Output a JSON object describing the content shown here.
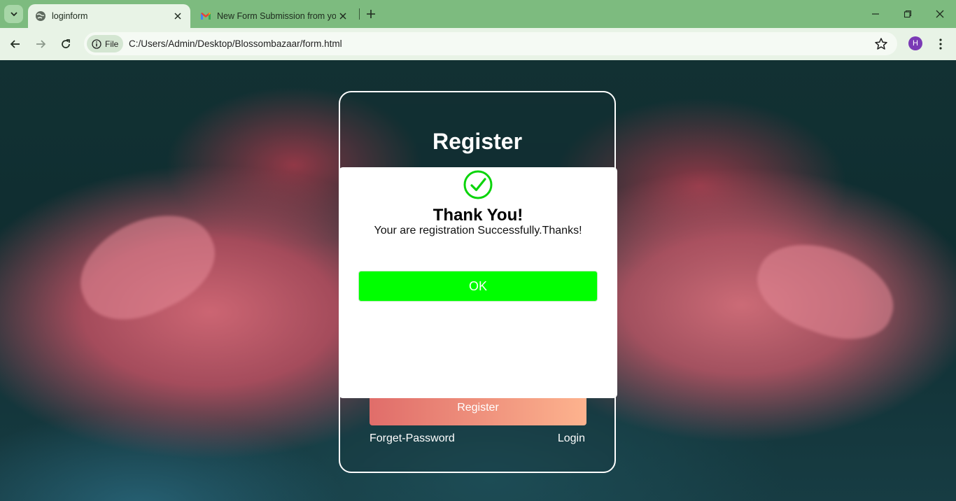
{
  "browser": {
    "tabs": [
      {
        "title": "loginform",
        "active": true,
        "icon": "globe-icon"
      },
      {
        "title": "New Form Submission from you",
        "active": false,
        "icon": "gmail-icon"
      }
    ],
    "address": {
      "chip_label": "File",
      "url": "C:/Users/Admin/Desktop/Blossombazaar/form.html"
    },
    "profile_initial": "H"
  },
  "form": {
    "title": "Register",
    "register_button": "Register",
    "forget_link": "Forget-Password",
    "login_link": "Login"
  },
  "modal": {
    "title": "Thank You!",
    "message": "Your are registration Successfully.Thanks!",
    "ok_button": "OK",
    "accent_color": "#00ff00"
  }
}
